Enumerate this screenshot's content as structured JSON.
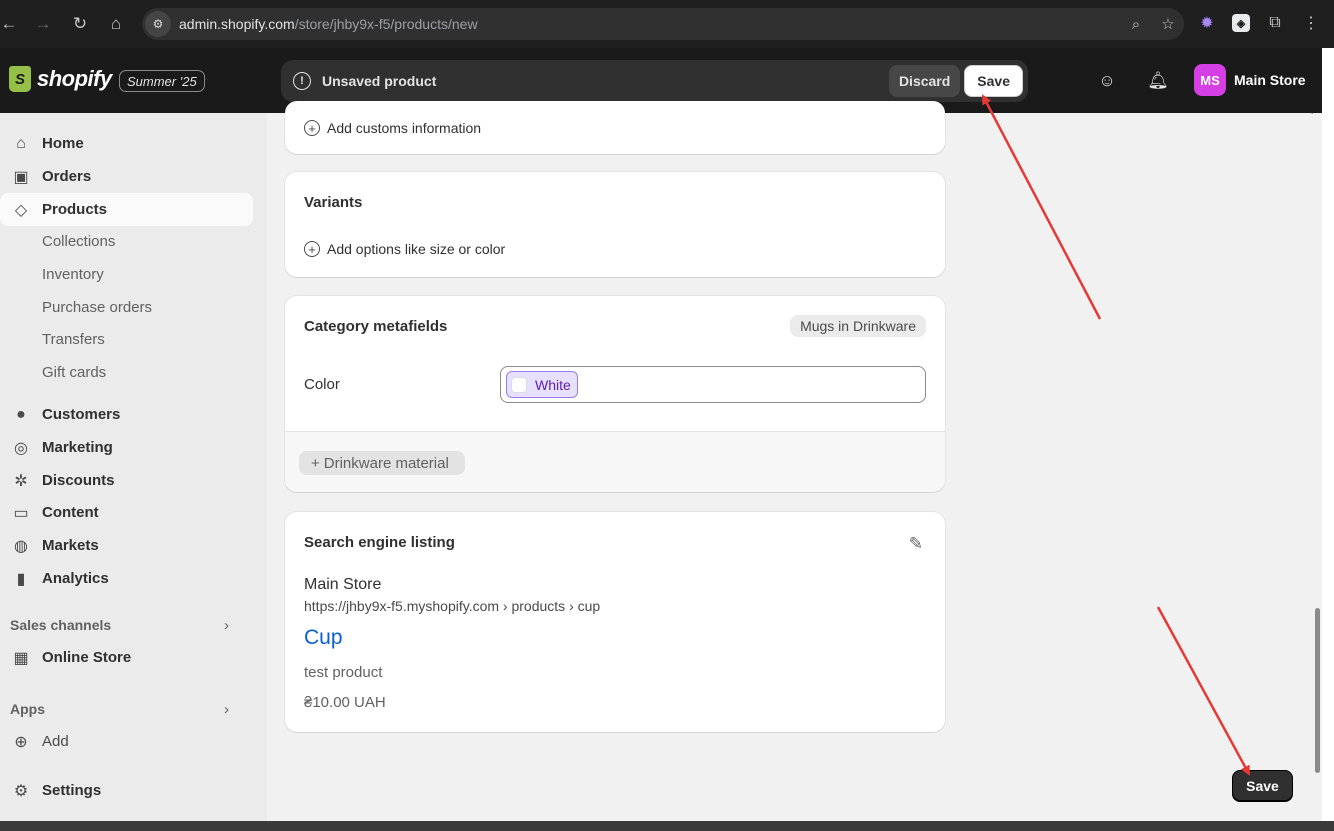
{
  "browser": {
    "url_host": "admin.shopify.com",
    "url_path": "/store/jhby9x-f5/products/new"
  },
  "topbar": {
    "logo_text": "shopify",
    "edition": "Summer '25",
    "context_title": "Unsaved product",
    "discard_label": "Discard",
    "save_label": "Save",
    "avatar_initials": "MS",
    "store_name": "Main Store"
  },
  "sidebar": {
    "items": [
      {
        "label": "Home",
        "icon": "home-icon"
      },
      {
        "label": "Orders",
        "icon": "inbox-icon"
      },
      {
        "label": "Products",
        "icon": "tag-icon"
      },
      {
        "label": "Customers",
        "icon": "person-icon"
      },
      {
        "label": "Marketing",
        "icon": "target-icon"
      },
      {
        "label": "Discounts",
        "icon": "discount-icon"
      },
      {
        "label": "Content",
        "icon": "image-icon"
      },
      {
        "label": "Markets",
        "icon": "globe-icon"
      },
      {
        "label": "Analytics",
        "icon": "bar-chart-icon"
      }
    ],
    "product_subitems": [
      "Collections",
      "Inventory",
      "Purchase orders",
      "Transfers",
      "Gift cards"
    ],
    "sales_channels_label": "Sales channels",
    "online_store_label": "Online Store",
    "apps_label": "Apps",
    "add_label": "Add",
    "settings_label": "Settings"
  },
  "main": {
    "customs_link": "Add customs information",
    "variants": {
      "title": "Variants",
      "add_options": "Add options like size or color"
    },
    "metafields": {
      "title": "Category metafields",
      "badge": "Mugs in Drinkware",
      "color_label": "Color",
      "color_value": "White",
      "add_material": "Drinkware material"
    },
    "seo": {
      "title": "Search engine listing",
      "store": "Main Store",
      "url": "https://jhby9x-f5.myshopify.com › products › cup",
      "product_title": "Cup",
      "description": "test product",
      "price": "₴10.00 UAH"
    },
    "save_bottom": "Save"
  },
  "colors": {
    "annotation_arrow": "#e53935",
    "seo_title": "#0b5fd6",
    "avatar_bg": "#d63fe4"
  }
}
